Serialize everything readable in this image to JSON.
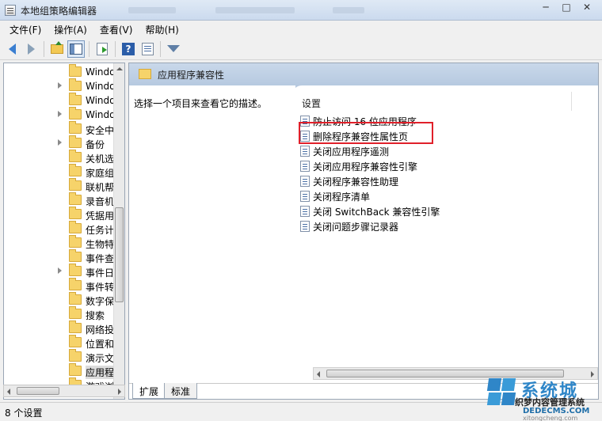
{
  "window": {
    "title": "本地组策略编辑器"
  },
  "menu": [
    "文件(F)",
    "操作(A)",
    "查看(V)",
    "帮助(H)"
  ],
  "tree": {
    "items": [
      {
        "label": "Windo",
        "expander": false
      },
      {
        "label": "Windo",
        "expander": true
      },
      {
        "label": "Windo",
        "expander": false
      },
      {
        "label": "Windo",
        "expander": true
      },
      {
        "label": "安全中",
        "expander": false
      },
      {
        "label": "备份",
        "expander": true
      },
      {
        "label": "关机选",
        "expander": false
      },
      {
        "label": "家庭组",
        "expander": false
      },
      {
        "label": "联机帮",
        "expander": false
      },
      {
        "label": "录音机",
        "expander": false
      },
      {
        "label": "凭据用",
        "expander": false
      },
      {
        "label": "任务计",
        "expander": false
      },
      {
        "label": "生物特",
        "expander": false
      },
      {
        "label": "事件查",
        "expander": false
      },
      {
        "label": "事件日",
        "expander": true
      },
      {
        "label": "事件转",
        "expander": false
      },
      {
        "label": "数字保",
        "expander": false
      },
      {
        "label": "搜索",
        "expander": false
      },
      {
        "label": "网络投",
        "expander": false
      },
      {
        "label": "位置和",
        "expander": false
      },
      {
        "label": "演示文",
        "expander": false
      },
      {
        "label": "应用程",
        "expander": false,
        "selected": true
      },
      {
        "label": "游戏浏",
        "expander": false
      }
    ]
  },
  "right": {
    "header_title": "应用程序兼容性",
    "description": "选择一个项目来查看它的描述。",
    "column_header": "设置",
    "settings": [
      "防止访问 16 位应用程序",
      "删除程序兼容性属性页",
      "关闭应用程序遥测",
      "关闭应用程序兼容性引擎",
      "关闭程序兼容性助理",
      "关闭程序清单",
      "关闭 SwitchBack 兼容性引擎",
      "关闭问题步骤记录器"
    ],
    "tabs": [
      "扩展",
      "标准"
    ]
  },
  "status": {
    "text": "8 个设置"
  },
  "watermark": {
    "big": "系统城",
    "sub": "织梦内容管理系统",
    "url": "DEDECMS.COM",
    "url2": "xitongcheng.com"
  },
  "colors": {
    "highlight": "#e0202a",
    "header_bg": "#b6c9e0"
  }
}
